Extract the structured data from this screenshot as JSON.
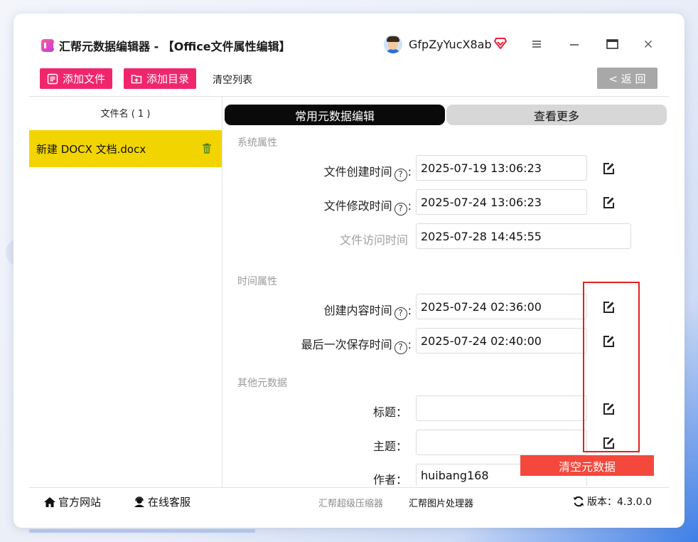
{
  "app": {
    "title": "汇帮元数据编辑器 - 【Office文件属性编辑】",
    "username": "GfpZyYucX8ab"
  },
  "toolbar": {
    "add_file": "添加文件",
    "add_dir": "添加目录",
    "clear_list": "清空列表",
    "back": "< 返 回"
  },
  "file_list": {
    "header": "文件名 ( 1 )",
    "items": [
      {
        "name": "新建 DOCX 文档.docx"
      }
    ]
  },
  "tabs": {
    "common": "常用元数据编辑",
    "more": "查看更多"
  },
  "sections": {
    "system": {
      "title": "系统属性",
      "created_label": "文件创建时间",
      "created_value": "2025-07-19 13:06:23",
      "modified_label": "文件修改时间",
      "modified_value": "2025-07-24 13:06:23",
      "accessed_label": "文件访问时间",
      "accessed_value": "2025-07-28 14:45:55"
    },
    "time": {
      "title": "时间属性",
      "content_created_label": "创建内容时间",
      "content_created_value": "2025-07-24 02:36:00",
      "last_saved_label": "最后一次保存时间",
      "last_saved_value": "2025-07-24 02:40:00"
    },
    "other": {
      "title": "其他元数据",
      "title_label": "标题：",
      "title_value": "",
      "subject_label": "主题：",
      "subject_value": "",
      "author_label": "作者：",
      "author_value": "huibang168"
    }
  },
  "help_glyph": "?",
  "colon": ":",
  "clear_metadata": "清空元数据",
  "footer": {
    "official_site": "官方网站",
    "online_service": "在线客服",
    "compressor": "汇帮超级压缩器",
    "image_tool": "汇帮图片处理器",
    "version": "版本：4.3.0.0"
  },
  "colors": {
    "accent_pink": "#f0266d",
    "selected_file": "#f2d500",
    "highlight": "#e2221c",
    "clear_button": "#f4483c"
  }
}
